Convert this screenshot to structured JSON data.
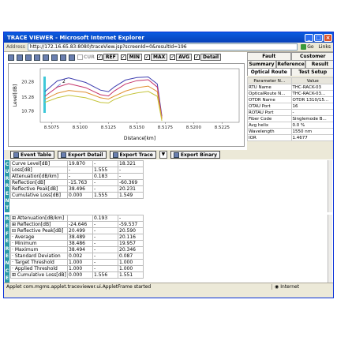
{
  "window": {
    "title": "TRACE VIEWER - Microsoft Internet Explorer",
    "min": "_",
    "max": "□",
    "close": "×"
  },
  "address": {
    "label": "Address",
    "url": "http://172.16.65.83:8080/traceView.jsp?screenId=0&resultId=196",
    "go": "Go",
    "links": "Links"
  },
  "toolbar": {
    "cur": "CUR",
    "ref": "REF",
    "min": "MIN",
    "max": "MAX",
    "avg": "AVG",
    "detail": "Detail"
  },
  "tabs": {
    "row1": [
      "Fault",
      "Customer"
    ],
    "row2": [
      "Summary",
      "Reference",
      "Result"
    ],
    "row3": [
      "Optical Route",
      "Test Setup"
    ]
  },
  "params": {
    "headers": [
      "Parameter N...",
      "Value"
    ],
    "rows": [
      [
        "RTU Name",
        "THC-RACK-03"
      ],
      [
        "OpticalRoute N...",
        "THC-RACK-03..."
      ],
      [
        "OTDR Name",
        "OTDR 1310/15..."
      ],
      [
        "OTAU Port",
        "16"
      ],
      [
        "ROTAU Port",
        "-"
      ],
      [
        "Fiber Code",
        "Singlemode B..."
      ],
      [
        "Avg helix",
        "0.0 %"
      ],
      [
        "Wavelength",
        "1550 nm"
      ],
      [
        "IOR",
        "1.4677"
      ]
    ]
  },
  "export": {
    "event_table": "Event Table",
    "detail": "Export Detail",
    "trace": "Export Trace",
    "binary": "Export Binary"
  },
  "current": {
    "label": "CURRENT",
    "rows": [
      [
        "Curve Level[dB]",
        "19.870",
        "-",
        "18.321"
      ],
      [
        "Loss[dB]",
        "-",
        "1.555",
        "-"
      ],
      [
        "Attenuation[dB/km]",
        "-",
        "0.183",
        "-"
      ],
      [
        "Reflection[dB]",
        "-15.763",
        "-",
        "-60.369"
      ],
      [
        "Reflective Peak[dB]",
        "38.496",
        "-",
        "20.231"
      ],
      [
        "Cumulative Loss[dB]",
        "0.000",
        "1.555",
        "1.549"
      ]
    ]
  },
  "reference": {
    "label": "REFERENCE",
    "rows": [
      [
        "⊞ Attenuation[dB/km]",
        "",
        "0.193",
        "-"
      ],
      [
        "⊞ Reflection[dB]",
        "-24.646",
        "-",
        "-59.537"
      ],
      [
        "⊟ Reflective Peak[dB]",
        "20.499",
        "-",
        "20.590"
      ],
      [
        "· Average",
        "38.489",
        "-",
        "20.116"
      ],
      [
        "· Minimum",
        "38.486",
        "-",
        "19.957"
      ],
      [
        "· Maximum",
        "38.494",
        "-",
        "20.346"
      ],
      [
        "· Standard Deviation",
        "0.002",
        "-",
        "0.087"
      ],
      [
        "· Target Threshold",
        "1.000",
        "-",
        "1.000"
      ],
      [
        "· Applied Threshold",
        "1.000",
        "-",
        "1.000"
      ],
      [
        "⊞ Cumulative Loss[dB]",
        "0.000",
        "1.556",
        "1.551"
      ]
    ]
  },
  "status": {
    "message": "Applet com.mgms.applet.traceviewer.ui.AppletFrame started",
    "zone": "Internet"
  },
  "chart_data": {
    "type": "line",
    "title": "",
    "xlabel": "Distance[km]",
    "ylabel": "Level[dB]",
    "xlim": [
      8.5065,
      8.524
    ],
    "ylim": [
      7,
      24.5
    ],
    "x_ticks": [
      "8.5075",
      "8.5100",
      "8.5125",
      "8.5150",
      "8.5175",
      "8.5200",
      "8.5225"
    ],
    "y_ticks": [
      "20.28",
      "15.28",
      "10.78"
    ],
    "marker_label": "2",
    "series": [
      {
        "color": "#3f3fb0",
        "x": [
          8.5069,
          8.508,
          8.509,
          8.5105,
          8.5118,
          8.5125,
          8.513,
          8.514,
          8.515,
          8.516,
          8.5168,
          8.5172
        ],
        "y": [
          17,
          20.5,
          21.5,
          20,
          17.5,
          17,
          18.5,
          20.8,
          21.6,
          21.8,
          19.5,
          9
        ]
      },
      {
        "color": "#c4326a",
        "x": [
          8.5069,
          8.508,
          8.509,
          8.5105,
          8.5118,
          8.5125,
          8.513,
          8.514,
          8.515,
          8.516,
          8.5168,
          8.5172
        ],
        "y": [
          15.5,
          18.5,
          19.6,
          18.3,
          16,
          15.6,
          17.2,
          19.5,
          20.6,
          20.9,
          18.5,
          8.5
        ]
      },
      {
        "color": "#e09030",
        "x": [
          8.5069,
          8.508,
          8.509,
          8.5105,
          8.5118,
          8.5125,
          8.513,
          8.514,
          8.515,
          8.516,
          8.5168,
          8.5172
        ],
        "y": [
          14.5,
          16.5,
          17.4,
          16.8,
          15,
          14.6,
          15.5,
          17.2,
          18.3,
          18.8,
          17,
          8
        ]
      },
      {
        "color": "#c4c43a",
        "x": [
          8.5069,
          8.508,
          8.509,
          8.5105,
          8.5118,
          8.5125,
          8.513,
          8.514,
          8.515,
          8.516,
          8.5168,
          8.5172
        ],
        "y": [
          13.5,
          15,
          15.8,
          15,
          13.5,
          13.3,
          14.4,
          15.8,
          16.6,
          17.1,
          15.5,
          7.5
        ]
      }
    ]
  }
}
